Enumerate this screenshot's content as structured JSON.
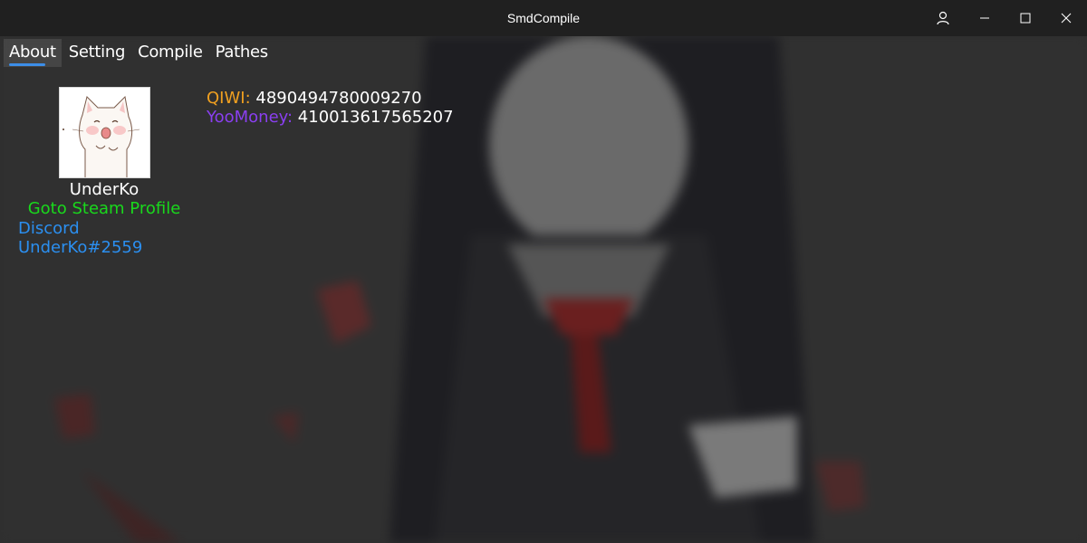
{
  "window": {
    "title": "SmdCompile",
    "buttons": {
      "user_icon": "user-icon",
      "minimize_icon": "minimize-icon",
      "maximize_icon": "maximize-icon",
      "close_icon": "close-icon"
    }
  },
  "tabs": [
    {
      "label": "About",
      "active": true
    },
    {
      "label": "Setting",
      "active": false
    },
    {
      "label": "Compile",
      "active": false
    },
    {
      "label": "Pathes",
      "active": false
    }
  ],
  "profile": {
    "username": "UnderKo",
    "steam_link": "Goto Steam Profile",
    "discord_link": "Discord UnderKo#2559"
  },
  "donations": {
    "qiwi": {
      "label": "QIWI:",
      "value": "4890494780009270"
    },
    "yoomoney": {
      "label": "YooMoney:",
      "value": "410013617565207"
    }
  },
  "colors": {
    "titlebar": "#202020",
    "accent": "#3c8ee8",
    "steam": "#19d91c",
    "discord": "#2b8ff0",
    "qiwi": "#f0a020",
    "yoomoney": "#8a3ff0"
  }
}
